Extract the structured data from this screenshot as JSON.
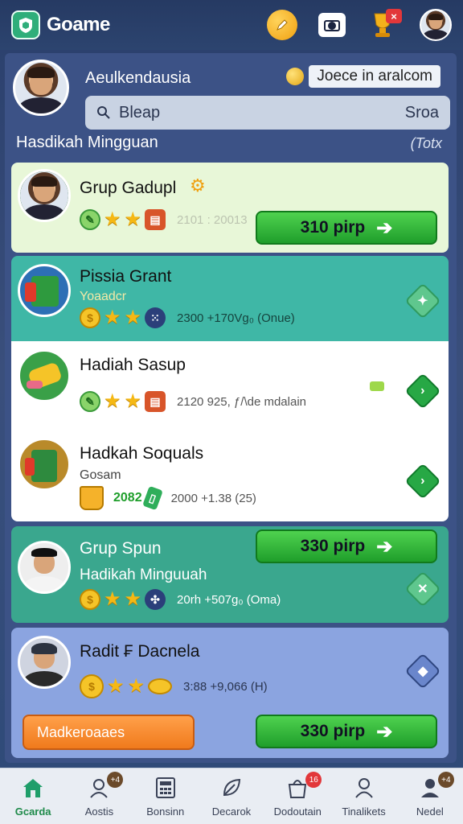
{
  "app": {
    "title": "Goame"
  },
  "topbar": {
    "trophy_badge": "×"
  },
  "profile": {
    "name": "Aeulkendausia",
    "coin_label": "Joece in aralcom"
  },
  "search": {
    "placeholder": "Bleap",
    "right_label": "Sroa"
  },
  "section": {
    "title": "Hasdikah Mingguan",
    "right": "(Totx"
  },
  "cards": [
    {
      "title": "Grup Gadupl",
      "meta": "2101 : 20013",
      "button": "310 pirp",
      "bg": "#e8f7d8"
    },
    {
      "title": "Pissia Grant",
      "subtitle": "Yoaadcr",
      "meta": "2300 +170Vg₀ (Onue)",
      "bg": "#3fb7a6"
    },
    {
      "title": "Hadiah Sasup",
      "meta": "2120 925, ƒ/\\de mdalain",
      "bg": "#ffffff"
    },
    {
      "title": "Hadkah Soquals",
      "subtitle": "Gosam",
      "meta_green": "2082",
      "meta": "2000 +1.38 (25)",
      "bg": "#ffffff"
    },
    {
      "title": "Grup Spun",
      "subtitle": "Hadikah Minguuah",
      "meta": "20rh +507g₀ (Oma)",
      "button": "330 pirp",
      "bg": "#3aa78e"
    },
    {
      "title": "Radit ₣ Dacnela",
      "meta": "3:88 +9,066 (H)",
      "bg": "#8ba4e0"
    }
  ],
  "bottom_actions": {
    "orange": "Madkeroaaes",
    "green": "330 pirp"
  },
  "tabs": [
    {
      "label": "Gcarda",
      "badge": ""
    },
    {
      "label": "Aostis",
      "badge": "+4"
    },
    {
      "label": "Bonsinn",
      "badge": ""
    },
    {
      "label": "Decarok",
      "badge": ""
    },
    {
      "label": "Dodoutain",
      "badge": "16"
    },
    {
      "label": "Tinalikets",
      "badge": ""
    },
    {
      "label": "Nedel",
      "badge": "+4"
    }
  ],
  "colors": {
    "accent_green": "#1f9e2b",
    "panel": "#3c5286",
    "topbar": "#263a63",
    "orange": "#f07a1c"
  }
}
